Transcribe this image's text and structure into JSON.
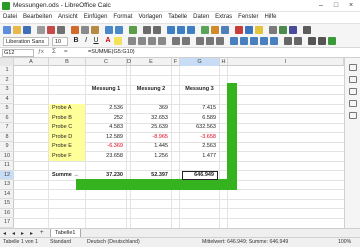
{
  "window": {
    "title": "Messungen.ods - LibreOffice Calc"
  },
  "menu": [
    "Datei",
    "Bearbeiten",
    "Ansicht",
    "Einfügen",
    "Format",
    "Vorlagen",
    "Tabelle",
    "Daten",
    "Extras",
    "Fenster",
    "Hilfe"
  ],
  "toolbar": {
    "font_name": "Liberation Sans",
    "font_size": "10"
  },
  "formula_bar": {
    "name_box": "G12",
    "formula": "=SUMME(G5:G10)"
  },
  "columns": [
    "A",
    "B",
    "C",
    "D",
    "E",
    "F",
    "G",
    "H",
    "I"
  ],
  "rows": [
    "1",
    "2",
    "3",
    "4",
    "5",
    "6",
    "7",
    "8",
    "9",
    "10",
    "11",
    "12",
    "13",
    "14",
    "15",
    "16",
    "17"
  ],
  "table": {
    "headers": [
      "Messung 1",
      "Messung 2",
      "Messung 3"
    ],
    "rows": [
      {
        "label": "Probe A",
        "v": [
          "2.536",
          "369",
          "7.415"
        ]
      },
      {
        "label": "Probe B",
        "v": [
          "252",
          "32.653",
          "6.589"
        ]
      },
      {
        "label": "Probe C",
        "v": [
          "4.583",
          "25.639",
          "632.563"
        ]
      },
      {
        "label": "Probe D",
        "v": [
          "12.589",
          "-8.965",
          "-3.658"
        ]
      },
      {
        "label": "Probe E",
        "v": [
          "-6.369",
          "1.445",
          "2.563"
        ]
      },
      {
        "label": "Probe F",
        "v": [
          "23.658",
          "1.256",
          "1.477"
        ]
      }
    ],
    "sum_label": "Summe →",
    "sums": [
      "37.230",
      "52.397",
      "646.949"
    ]
  },
  "sheet_tab": "Tabelle1",
  "status": {
    "sheet": "Tabelle 1 von 1",
    "style": "Standard",
    "language": "Deutsch (Deutschland)",
    "summary": "Mittelwert: 646.949; Summe: 646.949",
    "zoom": "100%"
  },
  "colors": {
    "accent_green": "#35b31e",
    "negative": "#e0001a",
    "highlight_yellow": "#ffff99"
  }
}
